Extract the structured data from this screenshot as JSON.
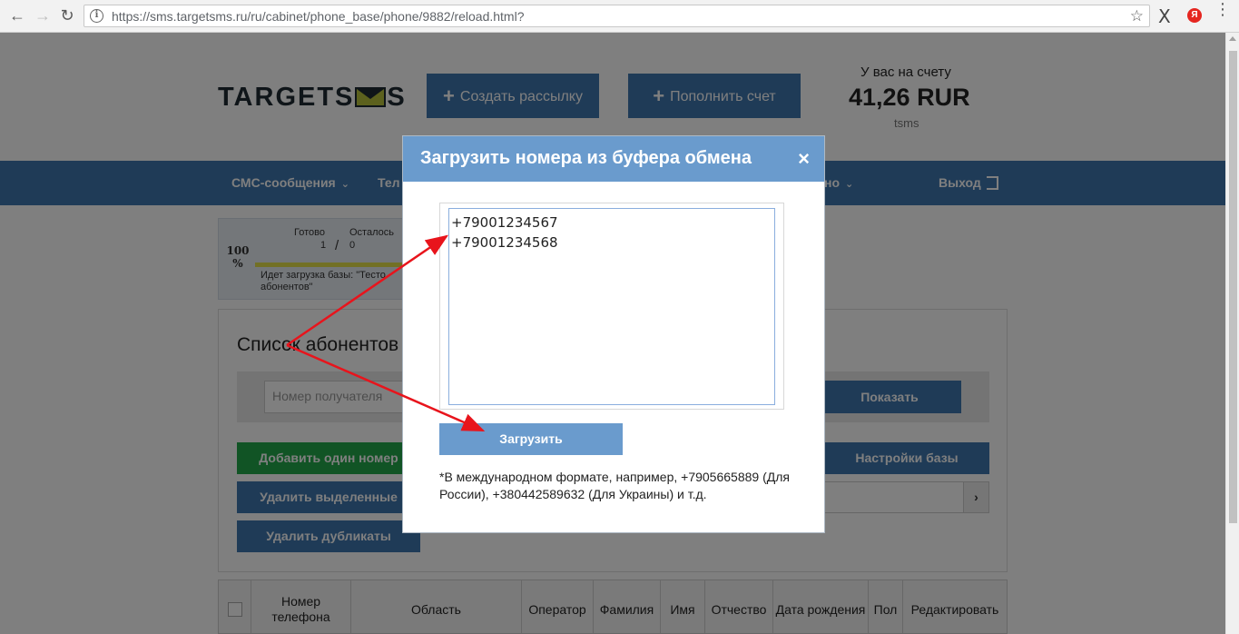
{
  "browser": {
    "url": "https://sms.targetsms.ru/ru/cabinet/phone_base/phone/9882/reload.html?"
  },
  "header": {
    "logo_left": "TARGETS",
    "logo_right": "S",
    "create_btn": "Создать рассылку",
    "topup_btn": "Пополнить счет",
    "balance_label": "У вас на счету",
    "balance_value": "41,26 RUR",
    "balance_currency": "tsms"
  },
  "nav": {
    "sms": "СМС-сообщения",
    "tel": "Тел",
    "right_partial": "но",
    "exit": "Выход"
  },
  "progress": {
    "percent": "100 %",
    "ready_label": "Готово",
    "left_label": "Осталось",
    "ready_value": "1",
    "left_value": "0",
    "message": "Идет загрузка базы: \"Тесто абонентов\"",
    "fill": 1.0
  },
  "panel": {
    "title": "Список абонентов",
    "recipient_placeholder": "Номер получателя",
    "show_btn": "Показать",
    "add_btn": "Добавить один номер",
    "delete_btn": "Удалить выделенные",
    "dup_btn": "Удалить дубликаты",
    "settings_btn": "Настройки базы"
  },
  "table": {
    "headers": [
      "",
      "Номер телефона",
      "Область",
      "Оператор",
      "Фамилия",
      "Имя",
      "Отчество",
      "Дата рождения",
      "Пол",
      "Редактировать"
    ]
  },
  "modal": {
    "title": "Загрузить номера из буфера обмена",
    "close": "×",
    "numbers": "+79001234567\n+79001234568",
    "load_btn": "Загрузить",
    "hint": "*В международном формате, например, +7905665889 (Для России), +380442589632 (Для Украины) и т.д."
  },
  "colors": {
    "primary": "#3e76ae",
    "modal_header": "#6a9bcd",
    "success": "#22a84a",
    "annotation": "#e8141c"
  }
}
